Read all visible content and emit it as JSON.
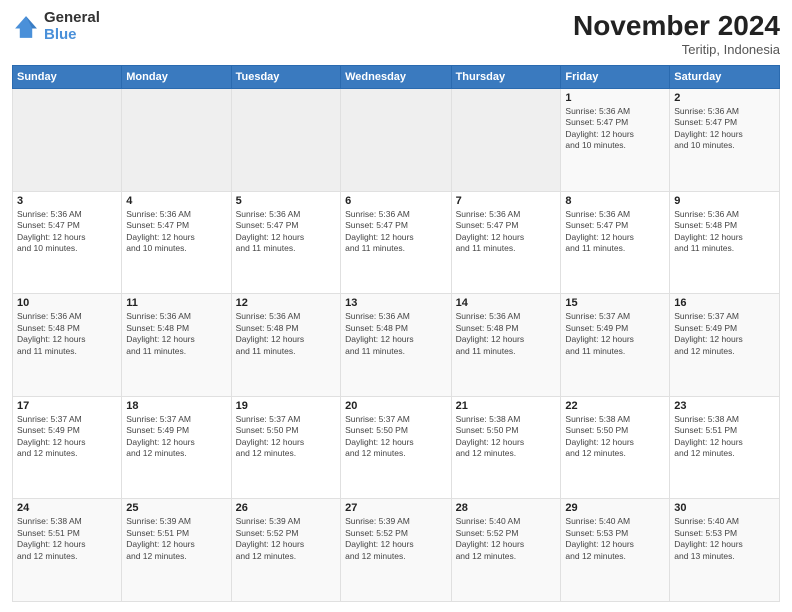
{
  "logo": {
    "general": "General",
    "blue": "Blue"
  },
  "header": {
    "month": "November 2024",
    "location": "Teritip, Indonesia"
  },
  "weekdays": [
    "Sunday",
    "Monday",
    "Tuesday",
    "Wednesday",
    "Thursday",
    "Friday",
    "Saturday"
  ],
  "weeks": [
    [
      {
        "day": "",
        "info": ""
      },
      {
        "day": "",
        "info": ""
      },
      {
        "day": "",
        "info": ""
      },
      {
        "day": "",
        "info": ""
      },
      {
        "day": "",
        "info": ""
      },
      {
        "day": "1",
        "info": "Sunrise: 5:36 AM\nSunset: 5:47 PM\nDaylight: 12 hours\nand 10 minutes."
      },
      {
        "day": "2",
        "info": "Sunrise: 5:36 AM\nSunset: 5:47 PM\nDaylight: 12 hours\nand 10 minutes."
      }
    ],
    [
      {
        "day": "3",
        "info": "Sunrise: 5:36 AM\nSunset: 5:47 PM\nDaylight: 12 hours\nand 10 minutes."
      },
      {
        "day": "4",
        "info": "Sunrise: 5:36 AM\nSunset: 5:47 PM\nDaylight: 12 hours\nand 10 minutes."
      },
      {
        "day": "5",
        "info": "Sunrise: 5:36 AM\nSunset: 5:47 PM\nDaylight: 12 hours\nand 11 minutes."
      },
      {
        "day": "6",
        "info": "Sunrise: 5:36 AM\nSunset: 5:47 PM\nDaylight: 12 hours\nand 11 minutes."
      },
      {
        "day": "7",
        "info": "Sunrise: 5:36 AM\nSunset: 5:47 PM\nDaylight: 12 hours\nand 11 minutes."
      },
      {
        "day": "8",
        "info": "Sunrise: 5:36 AM\nSunset: 5:47 PM\nDaylight: 12 hours\nand 11 minutes."
      },
      {
        "day": "9",
        "info": "Sunrise: 5:36 AM\nSunset: 5:48 PM\nDaylight: 12 hours\nand 11 minutes."
      }
    ],
    [
      {
        "day": "10",
        "info": "Sunrise: 5:36 AM\nSunset: 5:48 PM\nDaylight: 12 hours\nand 11 minutes."
      },
      {
        "day": "11",
        "info": "Sunrise: 5:36 AM\nSunset: 5:48 PM\nDaylight: 12 hours\nand 11 minutes."
      },
      {
        "day": "12",
        "info": "Sunrise: 5:36 AM\nSunset: 5:48 PM\nDaylight: 12 hours\nand 11 minutes."
      },
      {
        "day": "13",
        "info": "Sunrise: 5:36 AM\nSunset: 5:48 PM\nDaylight: 12 hours\nand 11 minutes."
      },
      {
        "day": "14",
        "info": "Sunrise: 5:36 AM\nSunset: 5:48 PM\nDaylight: 12 hours\nand 11 minutes."
      },
      {
        "day": "15",
        "info": "Sunrise: 5:37 AM\nSunset: 5:49 PM\nDaylight: 12 hours\nand 11 minutes."
      },
      {
        "day": "16",
        "info": "Sunrise: 5:37 AM\nSunset: 5:49 PM\nDaylight: 12 hours\nand 12 minutes."
      }
    ],
    [
      {
        "day": "17",
        "info": "Sunrise: 5:37 AM\nSunset: 5:49 PM\nDaylight: 12 hours\nand 12 minutes."
      },
      {
        "day": "18",
        "info": "Sunrise: 5:37 AM\nSunset: 5:49 PM\nDaylight: 12 hours\nand 12 minutes."
      },
      {
        "day": "19",
        "info": "Sunrise: 5:37 AM\nSunset: 5:50 PM\nDaylight: 12 hours\nand 12 minutes."
      },
      {
        "day": "20",
        "info": "Sunrise: 5:37 AM\nSunset: 5:50 PM\nDaylight: 12 hours\nand 12 minutes."
      },
      {
        "day": "21",
        "info": "Sunrise: 5:38 AM\nSunset: 5:50 PM\nDaylight: 12 hours\nand 12 minutes."
      },
      {
        "day": "22",
        "info": "Sunrise: 5:38 AM\nSunset: 5:50 PM\nDaylight: 12 hours\nand 12 minutes."
      },
      {
        "day": "23",
        "info": "Sunrise: 5:38 AM\nSunset: 5:51 PM\nDaylight: 12 hours\nand 12 minutes."
      }
    ],
    [
      {
        "day": "24",
        "info": "Sunrise: 5:38 AM\nSunset: 5:51 PM\nDaylight: 12 hours\nand 12 minutes."
      },
      {
        "day": "25",
        "info": "Sunrise: 5:39 AM\nSunset: 5:51 PM\nDaylight: 12 hours\nand 12 minutes."
      },
      {
        "day": "26",
        "info": "Sunrise: 5:39 AM\nSunset: 5:52 PM\nDaylight: 12 hours\nand 12 minutes."
      },
      {
        "day": "27",
        "info": "Sunrise: 5:39 AM\nSunset: 5:52 PM\nDaylight: 12 hours\nand 12 minutes."
      },
      {
        "day": "28",
        "info": "Sunrise: 5:40 AM\nSunset: 5:52 PM\nDaylight: 12 hours\nand 12 minutes."
      },
      {
        "day": "29",
        "info": "Sunrise: 5:40 AM\nSunset: 5:53 PM\nDaylight: 12 hours\nand 12 minutes."
      },
      {
        "day": "30",
        "info": "Sunrise: 5:40 AM\nSunset: 5:53 PM\nDaylight: 12 hours\nand 13 minutes."
      }
    ]
  ]
}
